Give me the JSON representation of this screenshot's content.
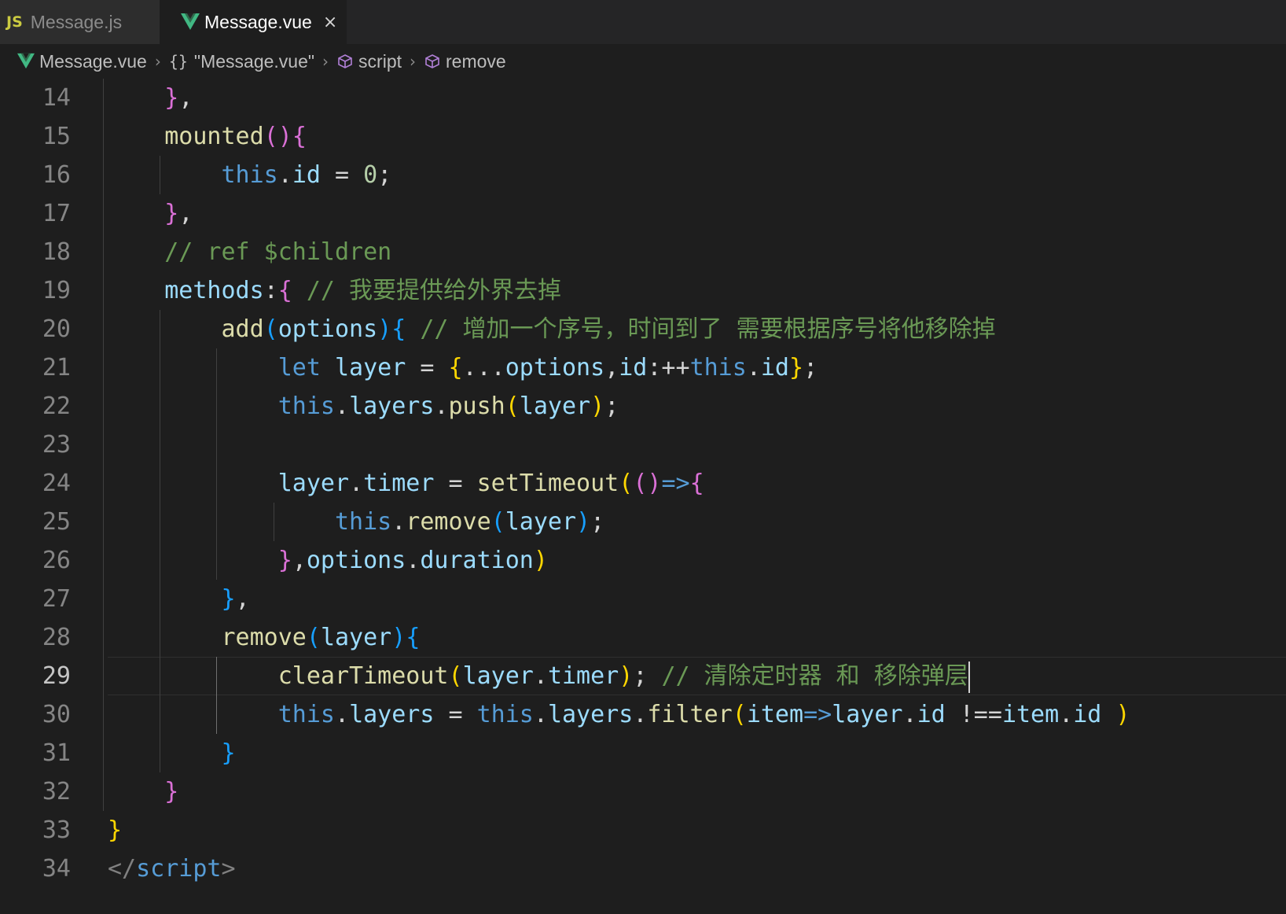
{
  "tabs": [
    {
      "icon": "js-file-icon",
      "icon_text": "JS",
      "label": "Message.js",
      "active": false
    },
    {
      "icon": "vue-file-icon",
      "label": "Message.vue",
      "active": true,
      "close": "×"
    }
  ],
  "breadcrumb": {
    "file": "Message.vue",
    "module": "\"Message.vue\"",
    "section": "script",
    "symbol": "remove"
  },
  "editor": {
    "current_line": 29,
    "line_numbers": [
      "14",
      "15",
      "16",
      "17",
      "18",
      "19",
      "20",
      "21",
      "22",
      "23",
      "24",
      "25",
      "26",
      "27",
      "28",
      "29",
      "30",
      "31",
      "32",
      "33",
      "34"
    ],
    "lines": [
      {
        "n": 14,
        "indent": 2,
        "tokens": [
          {
            "t": "}",
            "c": "b2"
          },
          {
            "t": ",",
            "c": "pl"
          }
        ]
      },
      {
        "n": 15,
        "indent": 2,
        "tokens": [
          {
            "t": "mounted",
            "c": "fn"
          },
          {
            "t": "()",
            "c": "b2"
          },
          {
            "t": "{",
            "c": "b2"
          }
        ]
      },
      {
        "n": 16,
        "indent": 4,
        "tokens": [
          {
            "t": "this",
            "c": "kw"
          },
          {
            "t": ".",
            "c": "pl"
          },
          {
            "t": "id",
            "c": "vr"
          },
          {
            "t": " = ",
            "c": "pl"
          },
          {
            "t": "0",
            "c": "nm"
          },
          {
            "t": ";",
            "c": "pl"
          }
        ]
      },
      {
        "n": 17,
        "indent": 2,
        "tokens": [
          {
            "t": "}",
            "c": "b2"
          },
          {
            "t": ",",
            "c": "pl"
          }
        ]
      },
      {
        "n": 18,
        "indent": 2,
        "tokens": [
          {
            "t": "// ref $children",
            "c": "cm"
          }
        ]
      },
      {
        "n": 19,
        "indent": 2,
        "tokens": [
          {
            "t": "methods",
            "c": "vr"
          },
          {
            "t": ":",
            "c": "pl"
          },
          {
            "t": "{",
            "c": "b2"
          },
          {
            "t": " // 我要提供给外界去掉",
            "c": "cm"
          }
        ]
      },
      {
        "n": 20,
        "indent": 4,
        "tokens": [
          {
            "t": "add",
            "c": "fn"
          },
          {
            "t": "(",
            "c": "b3"
          },
          {
            "t": "options",
            "c": "vr"
          },
          {
            "t": ")",
            "c": "b3"
          },
          {
            "t": "{",
            "c": "b3"
          },
          {
            "t": " // 增加一个序号，时间到了 需要根据序号将他移除掉",
            "c": "cm"
          }
        ]
      },
      {
        "n": 21,
        "indent": 6,
        "tokens": [
          {
            "t": "let",
            "c": "kw"
          },
          {
            "t": " ",
            "c": "pl"
          },
          {
            "t": "layer",
            "c": "vr"
          },
          {
            "t": " = ",
            "c": "pl"
          },
          {
            "t": "{",
            "c": "b1"
          },
          {
            "t": "...",
            "c": "pl"
          },
          {
            "t": "options",
            "c": "vr"
          },
          {
            "t": ",",
            "c": "pl"
          },
          {
            "t": "id",
            "c": "vr"
          },
          {
            "t": ":++",
            "c": "pl"
          },
          {
            "t": "this",
            "c": "kw"
          },
          {
            "t": ".",
            "c": "pl"
          },
          {
            "t": "id",
            "c": "vr"
          },
          {
            "t": "}",
            "c": "b1"
          },
          {
            "t": ";",
            "c": "pl"
          }
        ]
      },
      {
        "n": 22,
        "indent": 6,
        "tokens": [
          {
            "t": "this",
            "c": "kw"
          },
          {
            "t": ".",
            "c": "pl"
          },
          {
            "t": "layers",
            "c": "vr"
          },
          {
            "t": ".",
            "c": "pl"
          },
          {
            "t": "push",
            "c": "fn"
          },
          {
            "t": "(",
            "c": "b1"
          },
          {
            "t": "layer",
            "c": "vr"
          },
          {
            "t": ")",
            "c": "b1"
          },
          {
            "t": ";",
            "c": "pl"
          }
        ]
      },
      {
        "n": 23,
        "indent": 0,
        "tokens": []
      },
      {
        "n": 24,
        "indent": 6,
        "tokens": [
          {
            "t": "layer",
            "c": "vr"
          },
          {
            "t": ".",
            "c": "pl"
          },
          {
            "t": "timer",
            "c": "vr"
          },
          {
            "t": " = ",
            "c": "pl"
          },
          {
            "t": "setTimeout",
            "c": "fn"
          },
          {
            "t": "(",
            "c": "b1"
          },
          {
            "t": "()",
            "c": "b2"
          },
          {
            "t": "=>",
            "c": "kw"
          },
          {
            "t": "{",
            "c": "b2"
          }
        ]
      },
      {
        "n": 25,
        "indent": 8,
        "tokens": [
          {
            "t": "this",
            "c": "kw"
          },
          {
            "t": ".",
            "c": "pl"
          },
          {
            "t": "remove",
            "c": "fn"
          },
          {
            "t": "(",
            "c": "b3"
          },
          {
            "t": "layer",
            "c": "vr"
          },
          {
            "t": ")",
            "c": "b3"
          },
          {
            "t": ";",
            "c": "pl"
          }
        ]
      },
      {
        "n": 26,
        "indent": 6,
        "tokens": [
          {
            "t": "}",
            "c": "b2"
          },
          {
            "t": ",",
            "c": "pl"
          },
          {
            "t": "options",
            "c": "vr"
          },
          {
            "t": ".",
            "c": "pl"
          },
          {
            "t": "duration",
            "c": "vr"
          },
          {
            "t": ")",
            "c": "b1"
          }
        ]
      },
      {
        "n": 27,
        "indent": 4,
        "tokens": [
          {
            "t": "}",
            "c": "b3"
          },
          {
            "t": ",",
            "c": "pl"
          }
        ]
      },
      {
        "n": 28,
        "indent": 4,
        "tokens": [
          {
            "t": "remove",
            "c": "fn"
          },
          {
            "t": "(",
            "c": "b3"
          },
          {
            "t": "layer",
            "c": "vr"
          },
          {
            "t": ")",
            "c": "b3"
          },
          {
            "t": "{",
            "c": "b3"
          }
        ]
      },
      {
        "n": 29,
        "indent": 6,
        "tokens": [
          {
            "t": "clearTimeout",
            "c": "fn"
          },
          {
            "t": "(",
            "c": "b1"
          },
          {
            "t": "layer",
            "c": "vr"
          },
          {
            "t": ".",
            "c": "pl"
          },
          {
            "t": "timer",
            "c": "vr"
          },
          {
            "t": ")",
            "c": "b1"
          },
          {
            "t": "; ",
            "c": "pl"
          },
          {
            "t": "// 清除定时器 和 移除弹层",
            "c": "cm"
          }
        ],
        "caret": true
      },
      {
        "n": 30,
        "indent": 6,
        "tokens": [
          {
            "t": "this",
            "c": "kw"
          },
          {
            "t": ".",
            "c": "pl"
          },
          {
            "t": "layers",
            "c": "vr"
          },
          {
            "t": " = ",
            "c": "pl"
          },
          {
            "t": "this",
            "c": "kw"
          },
          {
            "t": ".",
            "c": "pl"
          },
          {
            "t": "layers",
            "c": "vr"
          },
          {
            "t": ".",
            "c": "pl"
          },
          {
            "t": "filter",
            "c": "fn"
          },
          {
            "t": "(",
            "c": "b1"
          },
          {
            "t": "item",
            "c": "vr"
          },
          {
            "t": "=>",
            "c": "kw"
          },
          {
            "t": "layer",
            "c": "vr"
          },
          {
            "t": ".",
            "c": "pl"
          },
          {
            "t": "id",
            "c": "vr"
          },
          {
            "t": " !==",
            "c": "pl"
          },
          {
            "t": "item",
            "c": "vr"
          },
          {
            "t": ".",
            "c": "pl"
          },
          {
            "t": "id",
            "c": "vr"
          },
          {
            "t": " ",
            "c": "pl"
          },
          {
            "t": ")",
            "c": "b1"
          }
        ]
      },
      {
        "n": 31,
        "indent": 4,
        "tokens": [
          {
            "t": "}",
            "c": "b3"
          }
        ]
      },
      {
        "n": 32,
        "indent": 2,
        "tokens": [
          {
            "t": "}",
            "c": "b2"
          }
        ]
      },
      {
        "n": 33,
        "indent": 0,
        "tokens": [
          {
            "t": "}",
            "c": "b1"
          }
        ]
      },
      {
        "n": 34,
        "indent": 0,
        "tokens": [
          {
            "t": "</",
            "c": "tg"
          },
          {
            "t": "script",
            "c": "kw"
          },
          {
            "t": ">",
            "c": "tg"
          }
        ]
      }
    ]
  },
  "colors": {
    "background": "#1e1e1e",
    "keyword": "#569cd6",
    "function": "#dcdcaa",
    "variable": "#9cdcfe",
    "comment": "#6a9955",
    "number": "#b5cea8",
    "bracket_gold": "#ffd700",
    "bracket_orchid": "#da70d6",
    "bracket_blue": "#179fff",
    "vue_green": "#41b883"
  }
}
